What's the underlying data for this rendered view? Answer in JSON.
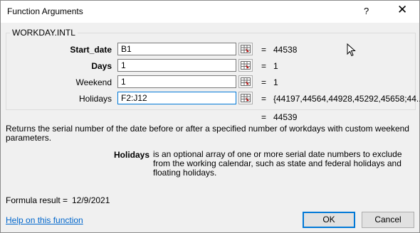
{
  "window": {
    "title": "Function Arguments",
    "help_glyph": "?",
    "close_glyph": "✕"
  },
  "function": {
    "name": "WORKDAY.INTL",
    "args": [
      {
        "label": "Start_date",
        "bold": true,
        "input": "B1",
        "value": "44538"
      },
      {
        "label": "Days",
        "bold": true,
        "input": "1",
        "value": "1"
      },
      {
        "label": "Weekend",
        "bold": false,
        "input": "1",
        "value": "1"
      },
      {
        "label": "Holidays",
        "bold": false,
        "input": "F2:J12",
        "value": "{44197,44564,44928,45292,45658;44..."
      }
    ],
    "equals_sign": "=",
    "result_value": "44539"
  },
  "description": "Returns the serial number of the date before or after a specified number of workdays with custom weekend parameters.",
  "arg_description": {
    "name": "Holidays",
    "text": "is an optional array of one or more serial date numbers to exclude from the working calendar, such as state and federal holidays and floating holidays."
  },
  "formula_result": {
    "label": "Formula result =",
    "value": "12/9/2021"
  },
  "help_link": "Help on this function",
  "buttons": {
    "ok": "OK",
    "cancel": "Cancel"
  },
  "icons": [
    "help-icon",
    "close-icon",
    "collapse-dialog-icon",
    "mouse-pointer-icon"
  ],
  "colors": {
    "accent": "#0078d7",
    "link": "#0066cc",
    "dialog_bg": "#f0f0f0"
  }
}
